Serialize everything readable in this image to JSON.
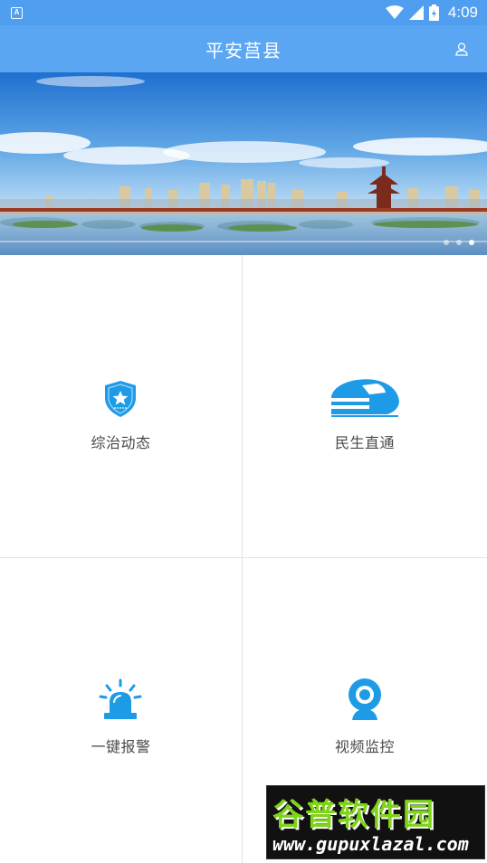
{
  "status_bar": {
    "notification_icon": "A",
    "time": "4:09",
    "icons": [
      "wifi-icon",
      "signal-icon",
      "battery-icon"
    ]
  },
  "app_bar": {
    "title": "平安莒县",
    "user_icon": "user-icon"
  },
  "banner": {
    "slide_count": 3,
    "active_index": 0
  },
  "tiles": [
    {
      "label": "综治动态",
      "icon": "police-badge-icon"
    },
    {
      "label": "民生直通",
      "icon": "train-icon"
    },
    {
      "label": "一键报警",
      "icon": "alarm-siren-icon"
    },
    {
      "label": "视频监控",
      "icon": "webcam-icon"
    }
  ],
  "watermark": {
    "title": "谷普软件园",
    "url": "www.gupuxlazal.com"
  },
  "colors": {
    "status_bar": "#4f9ef0",
    "app_bar": "#5aa6f3",
    "icon_blue": "#1e9be6",
    "label_text": "#4a4a4a",
    "divider": "#e2e2e2"
  }
}
